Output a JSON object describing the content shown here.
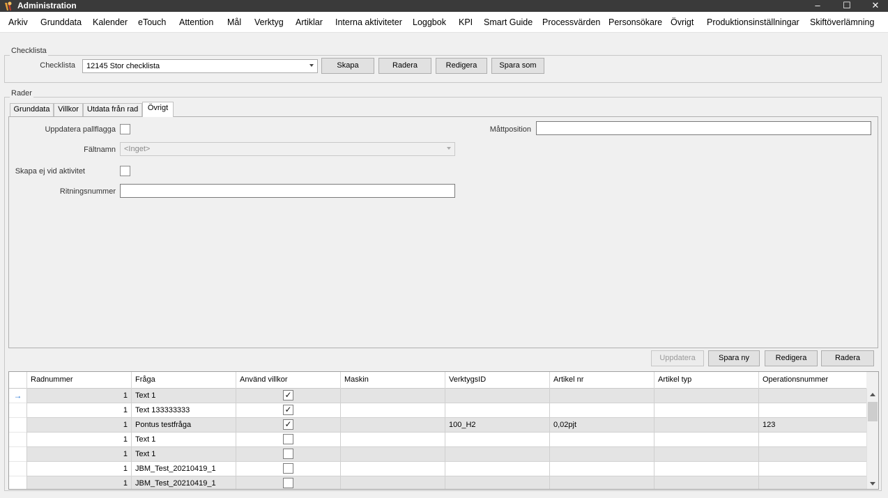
{
  "window": {
    "title": "Administration"
  },
  "menu": [
    "Arkiv",
    "Grunddata",
    "Kalender",
    "eTouch",
    "Attention",
    "Mål",
    "Verktyg",
    "Artiklar",
    "Interna aktiviteter",
    "Loggbok",
    "KPI",
    "Smart Guide",
    "Processvärden",
    "Personsökare",
    "Övrigt",
    "Produktionsinställningar",
    "Skiftöverlämning"
  ],
  "checklista_group": {
    "legend": "Checklista",
    "label": "Checklista",
    "selected": "12145 Stor checklista",
    "buttons": {
      "create": "Skapa",
      "delete": "Radera",
      "edit": "Redigera",
      "save_as": "Spara som"
    }
  },
  "rader_group": {
    "legend": "Rader",
    "tabs": [
      "Grunddata",
      "Villkor",
      "Utdata från rad",
      "Övrigt"
    ],
    "active_tab": "Övrigt"
  },
  "ovrigt_form": {
    "update_pallet_flag_label": "Uppdatera pallflagga",
    "field_name_label": "Fältnamn",
    "field_name_value": "<Inget>",
    "no_create_on_activity_label": "Skapa ej vid aktivitet",
    "drawing_number_label": "Ritningsnummer",
    "measure_position_label": "Måttposition"
  },
  "row_actions": {
    "update": "Uppdatera",
    "save_new": "Spara ny",
    "edit": "Redigera",
    "delete": "Radera"
  },
  "grid": {
    "columns": [
      "Radnummer",
      "Fråga",
      "Använd villkor",
      "Maskin",
      "VerktygsID",
      "Artikel nr",
      "Artikel typ",
      "Operationsnummer"
    ],
    "current_row_marker": "→",
    "check_mark": "✓",
    "rows": [
      {
        "radnummer": "1",
        "fraga": "Text 1",
        "anvand_villkor": true,
        "maskin": "",
        "verktygsid": "",
        "artikel_nr": "",
        "artikel_typ": "",
        "operationsnummer": ""
      },
      {
        "radnummer": "1",
        "fraga": "Text 133333333",
        "anvand_villkor": true,
        "maskin": "",
        "verktygsid": "",
        "artikel_nr": "",
        "artikel_typ": "",
        "operationsnummer": ""
      },
      {
        "radnummer": "1",
        "fraga": "Pontus testfråga",
        "anvand_villkor": true,
        "maskin": "",
        "verktygsid": "100_H2",
        "artikel_nr": "0,02pjt",
        "artikel_typ": "",
        "operationsnummer": "123"
      },
      {
        "radnummer": "1",
        "fraga": "Text 1",
        "anvand_villkor": false,
        "maskin": "",
        "verktygsid": "",
        "artikel_nr": "",
        "artikel_typ": "",
        "operationsnummer": ""
      },
      {
        "radnummer": "1",
        "fraga": "Text 1",
        "anvand_villkor": false,
        "maskin": "",
        "verktygsid": "",
        "artikel_nr": "",
        "artikel_typ": "",
        "operationsnummer": ""
      },
      {
        "radnummer": "1",
        "fraga": "JBM_Test_20210419_1",
        "anvand_villkor": false,
        "maskin": "",
        "verktygsid": "",
        "artikel_nr": "",
        "artikel_typ": "",
        "operationsnummer": ""
      },
      {
        "radnummer": "1",
        "fraga": "JBM_Test_20210419_1",
        "anvand_villkor": false,
        "maskin": "",
        "verktygsid": "",
        "artikel_nr": "",
        "artikel_typ": "",
        "operationsnummer": ""
      }
    ]
  },
  "window_controls": {
    "minimize": "–",
    "maximize": "☐",
    "close": "✕"
  },
  "colors": {
    "titlebar": "#3a3a3a",
    "grid_alt_row": "#e4e4e4",
    "row_marker": "#1e6fd0"
  }
}
